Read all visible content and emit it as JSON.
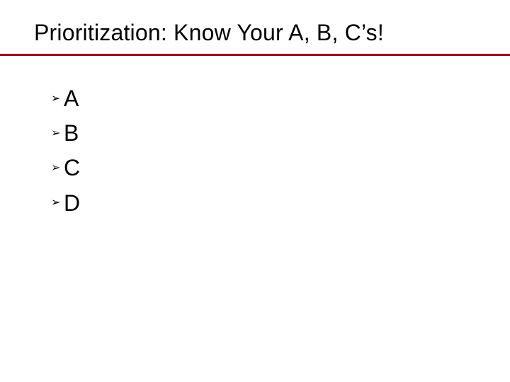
{
  "title": "Prioritization: Know Your A, B, C’s!",
  "bullet_glyph": "➢",
  "items": [
    "A",
    "B",
    "C",
    "D"
  ],
  "colors": {
    "rule": "#a00000",
    "text": "#000000",
    "background": "#ffffff"
  }
}
